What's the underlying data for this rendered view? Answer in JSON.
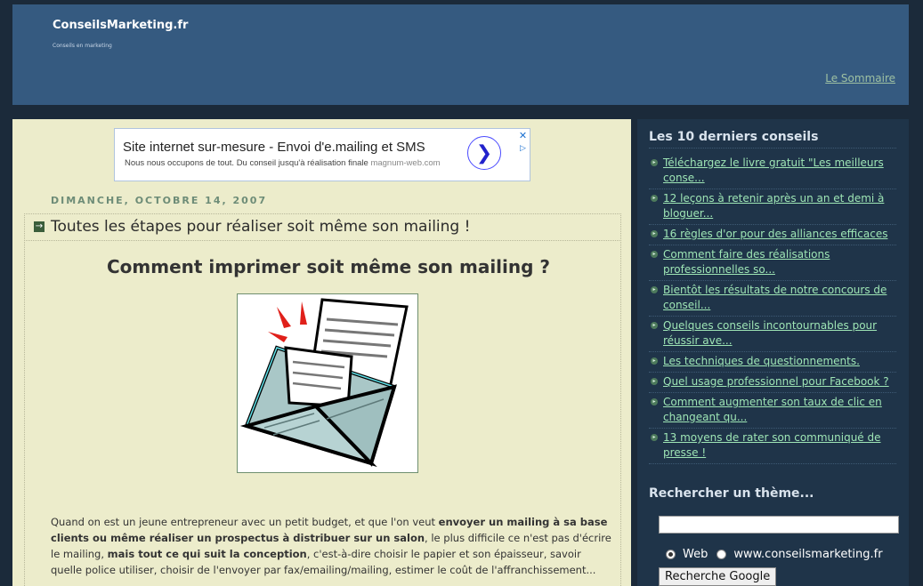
{
  "header": {
    "blog_title": "ConseilsMarketing.fr",
    "blog_description": "Conseils en marketing",
    "sommaire_link": "Le Sommaire"
  },
  "ad": {
    "title": "Site internet sur-mesure - Envoi d'e.mailing et SMS",
    "description": "Nous nous occupons de tout. Du conseil jusqu'à réalisation finale",
    "domain": "magnum-web.com",
    "go_icon": "chevron-right-icon",
    "close_icon": "close-icon",
    "info_icon": "adchoices-icon"
  },
  "post": {
    "date": "DIMANCHE, OCTOBRE 14, 2007",
    "title": "Toutes les étapes pour réaliser soit même son mailing !",
    "heading": "Comment imprimer soit même son mailing ?",
    "image_alt": "envelope-letter-illustration",
    "body": [
      {
        "text": "Quand on est un jeune entrepreneur avec un petit budget, et que l'on veut ",
        "bold": false
      },
      {
        "text": "envoyer un mailing à sa base clients ou même réaliser un prospectus à distribuer sur un salon",
        "bold": true
      },
      {
        "text": ", le plus difficile ce n'est pas d'écrire le mailing, ",
        "bold": false
      },
      {
        "text": "mais tout ce qui suit la conception",
        "bold": true
      },
      {
        "text": ", c'est-à-dire choisir le papier et son épaisseur, savoir quelle police utiliser, choisir de l'envoyer par fax/emailing/mailing, estimer le coût de l'affranchissement...",
        "bold": false
      }
    ]
  },
  "sidebar": {
    "recent_title": "Les 10 derniers conseils",
    "recent": [
      "Téléchargez le livre gratuit \"Les meilleurs conse...",
      "12 leçons à retenir après un an et demi à bloguer...",
      "16 règles d'or pour des alliances efficaces",
      "Comment faire des réalisations professionnelles so...",
      "Bientôt les résultats de notre concours de conseil...",
      "Quelques conseils incontournables pour réussir ave...",
      "Les techniques de questionnements.",
      "Quel usage professionnel pour Facebook ?",
      "Comment augmenter son taux de clic en changeant qu...",
      "13 moyens de rater son communiqué de presse !"
    ],
    "search_title": "Rechercher un thème...",
    "search_value": "",
    "radio_web": "Web",
    "radio_site": "www.conseilsmarketing.fr",
    "search_button": "Recherche Google"
  },
  "colors": {
    "page_bg": "#1b2a3a",
    "header_bg": "#355a80",
    "main_bg": "#ececcb",
    "sidebar_bg": "#1f3449",
    "link_green": "#9ee5b5"
  }
}
